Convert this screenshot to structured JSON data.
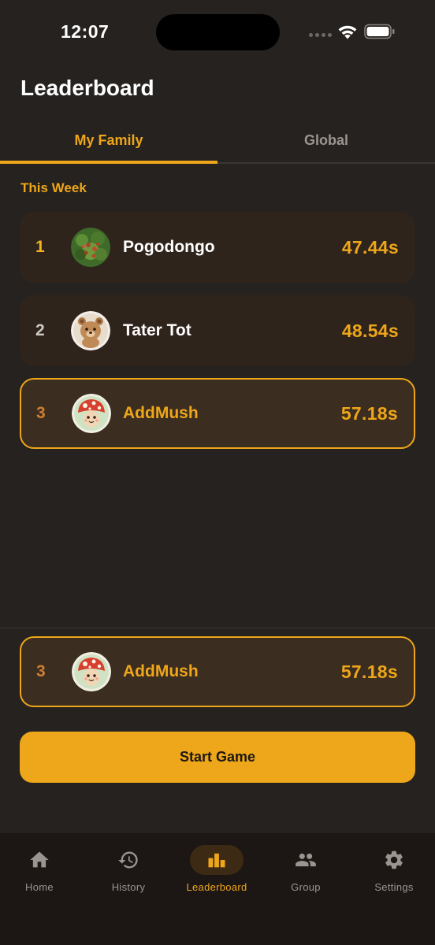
{
  "status_bar": {
    "time": "12:07"
  },
  "header": {
    "title": "Leaderboard"
  },
  "tabs": [
    {
      "label": "My Family",
      "active": true
    },
    {
      "label": "Global",
      "active": false
    }
  ],
  "section_title": "This Week",
  "leaderboard": [
    {
      "rank": "1",
      "name": "Pogodongo",
      "time": "47.44s",
      "rank_color": "#f2b51f",
      "avatar": "plant-avatar"
    },
    {
      "rank": "2",
      "name": "Tater Tot",
      "time": "48.54s",
      "rank_color": "#cfcac5",
      "avatar": "bear-avatar"
    },
    {
      "rank": "3",
      "name": "AddMush",
      "time": "57.18s",
      "rank_color": "#cd7f32",
      "avatar": "mushroom-avatar",
      "is_current_user": true
    }
  ],
  "current_user": {
    "rank": "3",
    "name": "AddMush",
    "time": "57.18s",
    "avatar": "mushroom-avatar"
  },
  "start_button": {
    "label": "Start Game"
  },
  "nav": [
    {
      "label": "Home",
      "icon": "home-icon"
    },
    {
      "label": "History",
      "icon": "history-icon"
    },
    {
      "label": "Leaderboard",
      "icon": "leaderboard-icon",
      "active": true
    },
    {
      "label": "Group",
      "icon": "group-icon"
    },
    {
      "label": "Settings",
      "icon": "settings-icon"
    }
  ],
  "colors": {
    "accent": "#eea61a",
    "background": "#252220",
    "row": "#2f241c",
    "row_highlight": "#3b2d1f",
    "nav_background": "#1c1615"
  }
}
